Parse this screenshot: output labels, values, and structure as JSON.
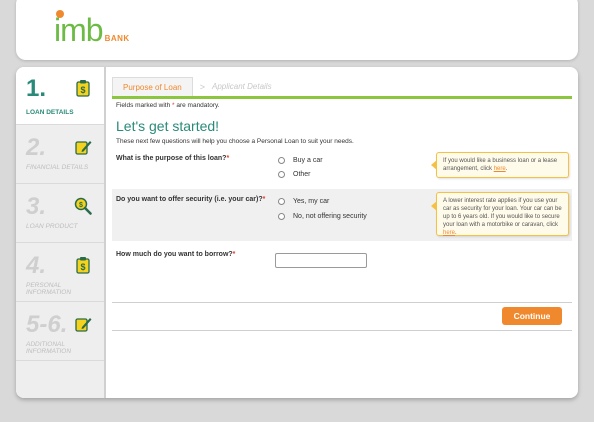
{
  "brand": {
    "name": "imb",
    "suffix": "BANK",
    "primary_color": "#6dbb45",
    "accent_color": "#f0892e",
    "teal_color": "#2a8a7a"
  },
  "sidebar": {
    "steps": [
      {
        "number": "1.",
        "label": "LOAN DETAILS",
        "icon": "clipboard-dollar-icon",
        "active": true
      },
      {
        "number": "2.",
        "label": "FINANCIAL DETAILS",
        "icon": "pen-document-icon",
        "active": false
      },
      {
        "number": "3.",
        "label": "LOAN PRODUCT",
        "icon": "magnifier-dollar-icon",
        "active": false
      },
      {
        "number": "4.",
        "label": "PERSONAL INFORMATION",
        "icon": "clipboard-dollar-icon",
        "active": false
      },
      {
        "number": "5-6.",
        "label": "ADDITIONAL INFORMATION",
        "icon": "pen-document-icon",
        "active": false
      }
    ]
  },
  "tabs": {
    "active": "Purpose of Loan",
    "separator": ">",
    "next": "Applicant Details"
  },
  "form": {
    "mandatory_prefix": "Fields marked with ",
    "mandatory_star": "*",
    "mandatory_suffix": " are mandatory.",
    "title": "Let's get started!",
    "intro": "These next few questions will help you choose a Personal Loan to suit your needs.",
    "q1": {
      "label": "What is the purpose of this loan?",
      "required": "*",
      "options": [
        "Buy a car",
        "Other"
      ],
      "tip_text": "If you would like a business loan or a lease arrangement, click ",
      "tip_link": "here",
      "tip_end": "."
    },
    "q2": {
      "label": "Do you want to offer security (i.e. your car)?",
      "required": "*",
      "options": [
        "Yes, my car",
        "No, not offering security"
      ],
      "tip_text": "A lower interest rate applies if you use your car as security for your loan. Your car can be up to 6 years old. If you would like to secure your loan with a motorbike or caravan, click ",
      "tip_link": "here",
      "tip_end": "."
    },
    "q3": {
      "label": "How much do you want to borrow?",
      "required": "*",
      "value": ""
    },
    "continue_label": "Continue"
  }
}
